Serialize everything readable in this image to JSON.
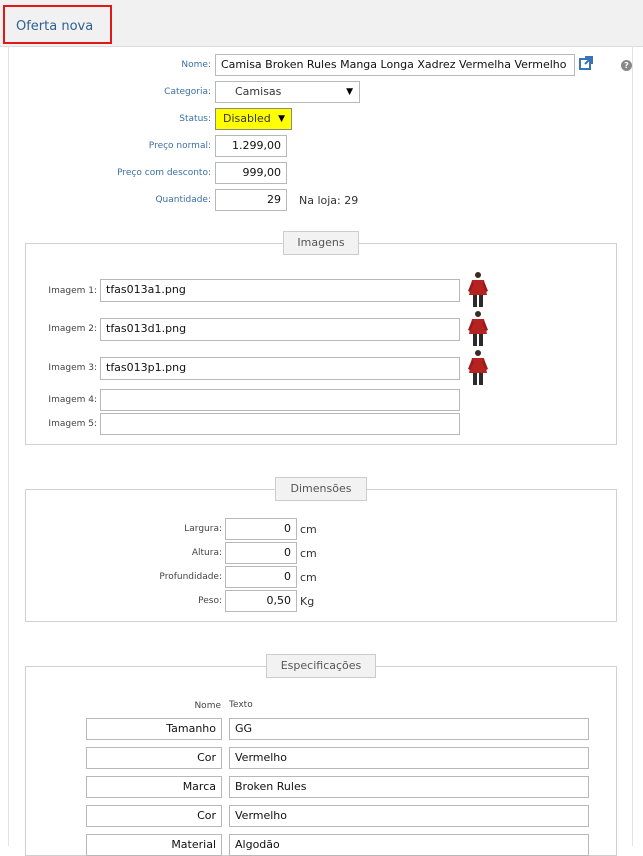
{
  "header": {
    "title": "Oferta nova",
    "help": "?"
  },
  "form": {
    "name_label": "Nome:",
    "name_value": "Camisa Broken Rules Manga Longa Xadrez Vermelha Vermelho",
    "category_label": "Categoria:",
    "category_value": "Camisas",
    "status_label": "Status:",
    "status_value": "Disabled",
    "price_label": "Preço normal:",
    "price_value": "1.299,00",
    "discount_label": "Preço com desconto:",
    "discount_value": "999,00",
    "quantity_label": "Quantidade:",
    "quantity_value": "29",
    "store_stock": "Na loja: 29"
  },
  "images": {
    "legend": "Imagens",
    "items": [
      {
        "label": "Imagem 1:",
        "value": "tfas013a1.png"
      },
      {
        "label": "Imagem 2:",
        "value": "tfas013d1.png"
      },
      {
        "label": "Imagem 3:",
        "value": "tfas013p1.png"
      },
      {
        "label": "Imagem 4:",
        "value": ""
      },
      {
        "label": "Imagem 5:",
        "value": ""
      }
    ]
  },
  "dimensions": {
    "legend": "Dimensões",
    "items": [
      {
        "label": "Largura:",
        "value": "0",
        "unit": "cm"
      },
      {
        "label": "Altura:",
        "value": "0",
        "unit": "cm"
      },
      {
        "label": "Profundidade:",
        "value": "0",
        "unit": "cm"
      },
      {
        "label": "Peso:",
        "value": "0,50",
        "unit": "Kg"
      }
    ]
  },
  "specs": {
    "legend": "Especificações",
    "name_header": "Nome",
    "text_header": "Texto",
    "rows": [
      {
        "name": "Tamanho",
        "text": "GG"
      },
      {
        "name": "Cor",
        "text": "Vermelho"
      },
      {
        "name": "Marca",
        "text": "Broken Rules"
      },
      {
        "name": "Cor",
        "text": "Vermelho"
      },
      {
        "name": "Material",
        "text": "Algodão"
      }
    ]
  },
  "colors": {
    "accent": "#2f5f95",
    "highlight": "#e01818",
    "status_bg": "#ffff00"
  },
  "icons": {
    "external_link": "external-link-icon",
    "help": "help-icon",
    "dropdown": "chevron-down-icon"
  }
}
